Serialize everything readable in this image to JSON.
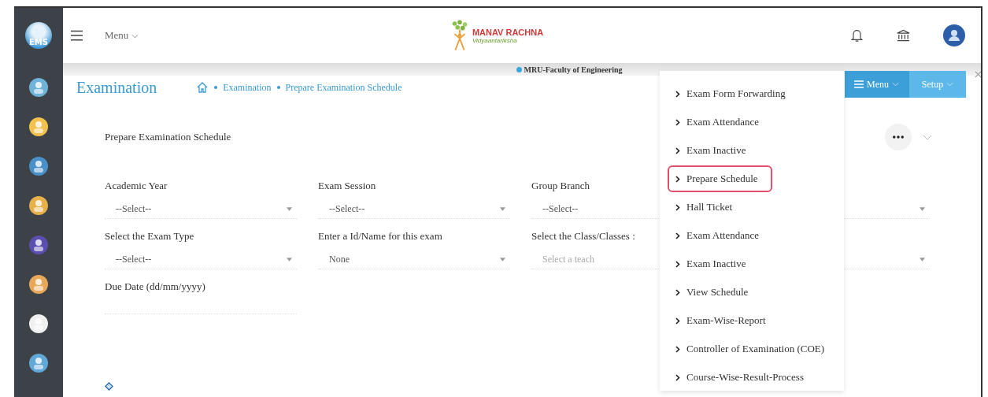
{
  "sidebar": {
    "logo": "EMS"
  },
  "header": {
    "menu_label": "Menu",
    "brand": "MANAV RACHNA",
    "brand_tagline": "Vidyaantariksha",
    "campus": "MRU-Faculty of Engineering"
  },
  "page": {
    "title": "Examination",
    "breadcrumb": [
      "Examination",
      "Prepare Examination Schedule"
    ]
  },
  "toolbar": {
    "buttons": [
      {
        "label": "Menu",
        "kind": "menu"
      },
      {
        "label": "Setup",
        "kind": "plain"
      }
    ]
  },
  "card": {
    "title": "Prepare Examination Schedule",
    "fields": [
      {
        "label": "Academic Year",
        "kind": "select",
        "value": "--Select--"
      },
      {
        "label": "Exam Session",
        "kind": "select",
        "value": "--Select--"
      },
      {
        "label": "Group Branch",
        "kind": "select",
        "value": "--Select--"
      },
      {
        "label": "Select the Exam Type",
        "kind": "select",
        "value": "--Select--"
      },
      {
        "label": "Enter a Id/Name for this exam",
        "kind": "select",
        "value": "None"
      },
      {
        "label": "Select the Class/Classes :",
        "kind": "multiselect",
        "placeholder": "Select a teach"
      },
      {
        "label": "Due Date (dd/mm/yyyy)",
        "kind": "date"
      }
    ]
  },
  "dropdown": {
    "items": [
      {
        "label": "Exam Form Forwarding",
        "selected": false
      },
      {
        "label": "Exam Attendance",
        "selected": false
      },
      {
        "label": "Exam Inactive",
        "selected": false
      },
      {
        "label": "Prepare Schedule",
        "selected": true
      },
      {
        "label": "Hall Ticket",
        "selected": false
      },
      {
        "label": "Exam Attendance",
        "selected": false
      },
      {
        "label": "Exam Inactive",
        "selected": false
      },
      {
        "label": "View Schedule",
        "selected": false
      },
      {
        "label": "Exam-Wise-Report",
        "selected": false
      },
      {
        "label": "Controller of Examination (COE)",
        "selected": false
      },
      {
        "label": "Course-Wise-Result-Process",
        "selected": false
      }
    ]
  }
}
